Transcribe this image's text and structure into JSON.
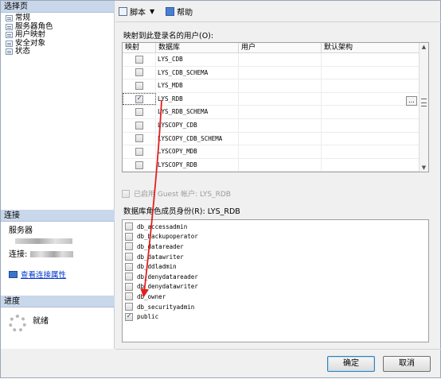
{
  "left_pane": {
    "select_page_title": "选择页",
    "pages": [
      "常规",
      "服务器角色",
      "用户映射",
      "安全对象",
      "状态"
    ],
    "connection_title": "连接",
    "server_label": "服务器",
    "connection_label": "连接:",
    "view_properties_link": "查看连接属性",
    "progress_title": "进度",
    "progress_status": "就绪"
  },
  "toolbar": {
    "script_label": "脚本",
    "help_label": "帮助"
  },
  "mapping": {
    "label": "映射到此登录名的用户(O):",
    "columns": [
      "映射",
      "数据库",
      "用户",
      "默认架构"
    ],
    "rows": [
      {
        "db": "LYS_CDB",
        "checked": false
      },
      {
        "db": "LYS_CDB_SCHEMA",
        "checked": false
      },
      {
        "db": "LYS_MDB",
        "checked": false
      },
      {
        "db": "LYS_RDB",
        "checked": true
      },
      {
        "db": "LYS_RDB_SCHEMA",
        "checked": false
      },
      {
        "db": "LYSCOPY_CDB",
        "checked": false
      },
      {
        "db": "LYSCOPY_CDB_SCHEMA",
        "checked": false
      },
      {
        "db": "LYSCOPY_MDB",
        "checked": false
      },
      {
        "db": "LYSCOPY_RDB",
        "checked": false
      }
    ],
    "ellipsis": "..."
  },
  "guest": {
    "label": "已启用 Guest 帐户: LYS_RDB",
    "enabled": false
  },
  "roles": {
    "label": "数据库角色成员身份(R): LYS_RDB",
    "items": [
      {
        "name": "db_accessadmin",
        "checked": false
      },
      {
        "name": "db_backupoperator",
        "checked": false
      },
      {
        "name": "db_datareader",
        "checked": false
      },
      {
        "name": "db_datawriter",
        "checked": false
      },
      {
        "name": "db_ddladmin",
        "checked": false
      },
      {
        "name": "db_denydatareader",
        "checked": false
      },
      {
        "name": "db_denydatawriter",
        "checked": false
      },
      {
        "name": "db_owner",
        "checked": false
      },
      {
        "name": "db_securityadmin",
        "checked": false
      },
      {
        "name": "public",
        "checked": true
      }
    ]
  },
  "buttons": {
    "ok": "确定",
    "cancel": "取消"
  },
  "annotation_color": "#e02020"
}
